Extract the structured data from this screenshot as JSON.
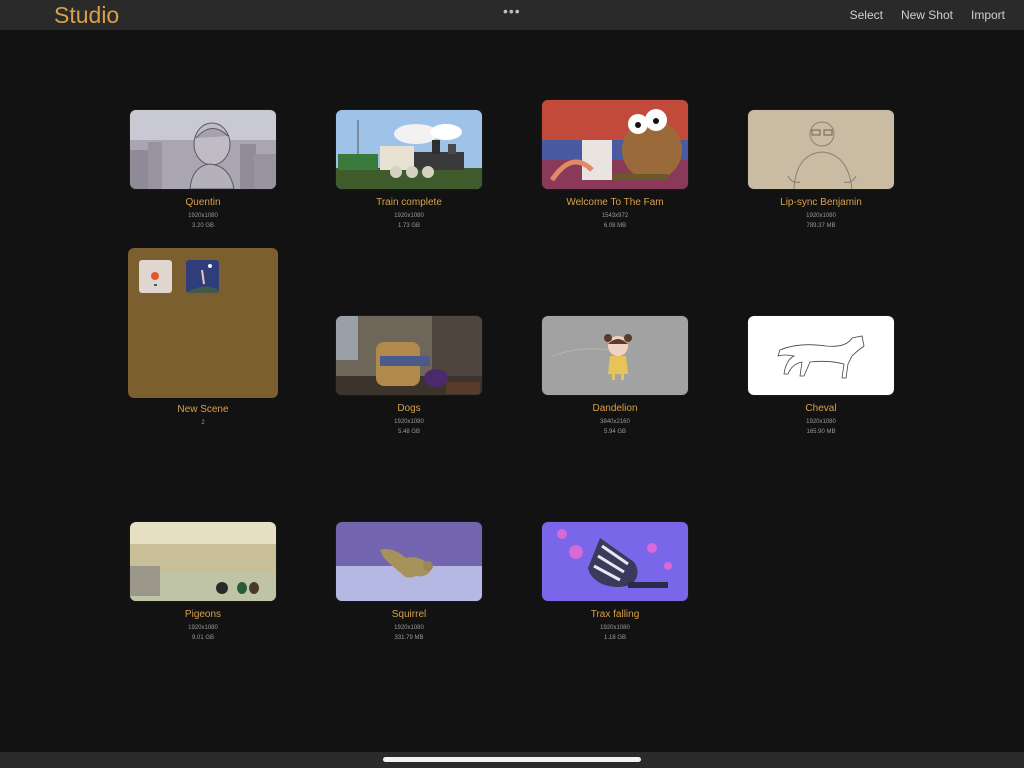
{
  "header": {
    "title": "Studio",
    "more_glyph": "•••",
    "actions": [
      "Select",
      "New Shot",
      "Import"
    ]
  },
  "tiles": [
    {
      "name": "Quentin",
      "resolution": "1920x1080",
      "size": "3.20 GB"
    },
    {
      "name": "Train complete",
      "resolution": "1920x1080",
      "size": "1.73 GB"
    },
    {
      "name": "Welcome To The Fam",
      "resolution": "1543x972",
      "size": "6.08 MB"
    },
    {
      "name": "Lip-sync Benjamin",
      "resolution": "1920x1080",
      "size": "789.37 MB"
    },
    {
      "name": "New Scene",
      "count": "2"
    },
    {
      "name": "Dogs",
      "resolution": "1920x1080",
      "size": "5.48 GB"
    },
    {
      "name": "Dandelion",
      "resolution": "3840x2160",
      "size": "5.94 GB"
    },
    {
      "name": "Cheval",
      "resolution": "1920x1080",
      "size": "165.90 MB"
    },
    {
      "name": "Pigeons",
      "resolution": "1920x1080",
      "size": "9.01 GB"
    },
    {
      "name": "Squirrel",
      "resolution": "1920x1080",
      "size": "331.79 MB"
    },
    {
      "name": "Trax falling",
      "resolution": "1920x1080",
      "size": "1.18 GB"
    }
  ],
  "colors": {
    "accent": "#d8a048",
    "background": "#121212",
    "bar": "#2a2a2a",
    "folder": "#7b5f2e"
  }
}
